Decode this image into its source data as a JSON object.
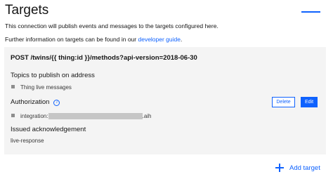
{
  "header": {
    "title": "Targets",
    "description": "This connection will publish events and messages to the targets configured here.",
    "further_info_prefix": "Further information on targets can be found in our ",
    "further_info_link": "developer guide",
    "further_info_suffix": "."
  },
  "target": {
    "address": "POST /twins/{{ thing:id }}/methods?api-version=2018-06-30",
    "topics_label": "Topics to publish on address",
    "topics": [
      "Thing live messages"
    ],
    "authorization_label": "Authorization",
    "authorization_entry_prefix": "integration:",
    "authorization_entry_suffix": ".aih",
    "ack_label": "Issued acknowledgement",
    "ack_value": "live-response",
    "delete_label": "Delete",
    "edit_label": "Edit"
  },
  "footer": {
    "add_target_label": "Add target"
  },
  "colors": {
    "accent": "#0f62fe",
    "card_bg": "#f4f4f4"
  }
}
